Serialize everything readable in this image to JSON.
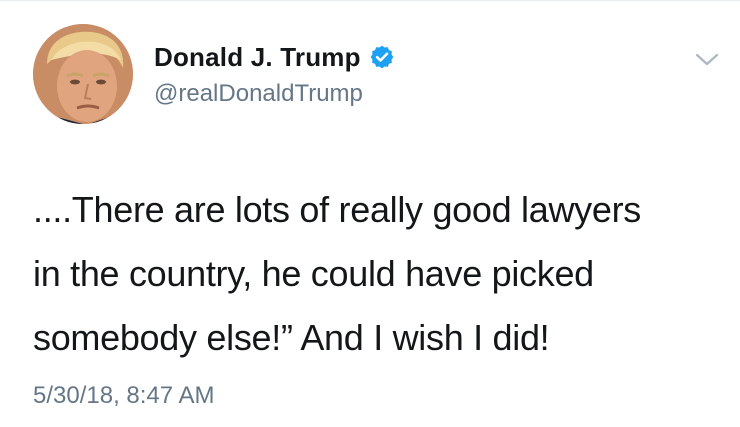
{
  "tweet": {
    "author": {
      "display_name": "Donald J. Trump",
      "handle": "@realDonaldTrump",
      "verified": true,
      "verified_icon": "verified-badge-icon",
      "avatar_icon": "profile-avatar"
    },
    "text_lines": [
      "....There are lots of really good lawyers",
      "in the country, he could have picked",
      "somebody else!” And I wish I did!"
    ],
    "timestamp": "5/30/18, 8:47 AM",
    "menu_icon": "chevron-down-icon"
  },
  "colors": {
    "text_primary": "#14171a",
    "text_secondary": "#657786",
    "verified_blue": "#1da1f2",
    "chevron": "#aab8c2",
    "background": "#ffffff"
  }
}
